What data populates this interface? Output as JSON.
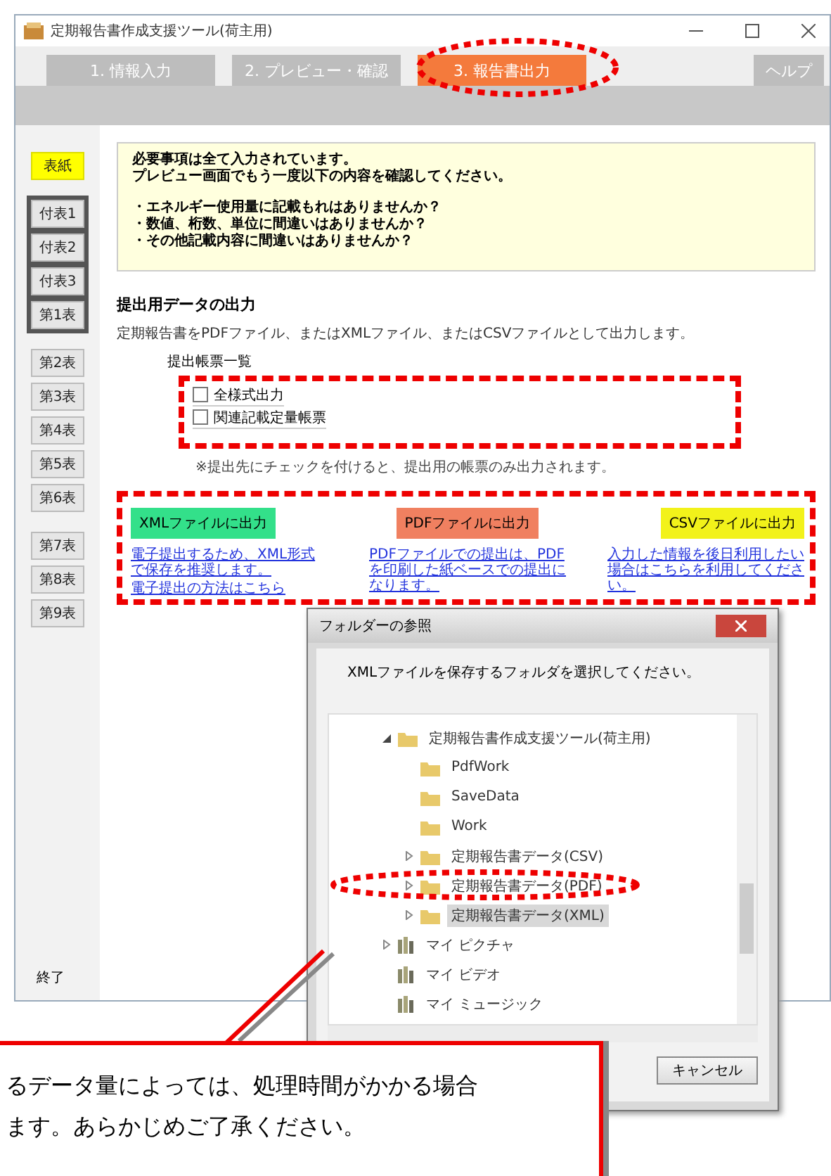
{
  "window": {
    "title": "定期報告書作成支援ツール(荷主用)"
  },
  "tabs": [
    {
      "label": "1. 情報入力",
      "selected": false
    },
    {
      "label": "2. プレビュー・確認",
      "selected": false
    },
    {
      "label": "3. 報告書出力",
      "selected": true
    }
  ],
  "help_button": "ヘルプ",
  "sidebar": {
    "groups": [
      {
        "boxed": false,
        "items": [
          {
            "label": "表紙",
            "selected": true
          }
        ]
      },
      {
        "boxed": true,
        "items": [
          {
            "label": "付表1",
            "selected": false
          },
          {
            "label": "付表2",
            "selected": false
          },
          {
            "label": "付表3",
            "selected": false
          },
          {
            "label": "第1表",
            "selected": false
          }
        ]
      },
      {
        "boxed": false,
        "items": [
          {
            "label": "第2表",
            "selected": false
          },
          {
            "label": "第3表",
            "selected": false
          },
          {
            "label": "第4表",
            "selected": false
          },
          {
            "label": "第5表",
            "selected": false
          },
          {
            "label": "第6表",
            "selected": false
          }
        ]
      },
      {
        "boxed": false,
        "items": [
          {
            "label": "第7表",
            "selected": false
          },
          {
            "label": "第8表",
            "selected": false
          },
          {
            "label": "第9表",
            "selected": false
          }
        ]
      }
    ],
    "exit_button": "終了"
  },
  "message": {
    "paragraphs": [
      [
        "必要事項は全て入力されています。",
        "プレビュー画面でもう一度以下の内容を確認してください。"
      ],
      [
        "・エネルギー使用量に記載もれはありませんか？",
        "・数値、桁数、単位に間違いはありませんか？",
        "・その他記載内容に間違いはありませんか？"
      ]
    ]
  },
  "output": {
    "title": "提出用データの出力",
    "description": "定期報告書をPDFファイル、またはXMLファイル、またはCSVファイルとして出力します。",
    "list_label": "提出帳票一覧",
    "options": [
      {
        "label": "全様式出力",
        "checked": false
      },
      {
        "label": "関連記載定量帳票",
        "checked": false
      }
    ],
    "note": "※提出先にチェックを付けると、提出用の帳票のみ出力されます。",
    "buttons": [
      {
        "label": "XMLファイルに出力",
        "color": "#33e08a",
        "links": [
          "電子提出するため、XML形式で保存を推奨します。",
          "電子提出の方法はこちら"
        ]
      },
      {
        "label": "PDFファイルに出力",
        "color": "#f08060",
        "links": [
          "PDFファイルでの提出は、PDFを印刷した紙ベースでの提出になります。"
        ]
      },
      {
        "label": "CSVファイルに出力",
        "color": "#f2f21a",
        "links": [
          "入力した情報を後日利用したい場合はこちらを利用してください。"
        ]
      }
    ]
  },
  "dialog": {
    "title": "フォルダーの参照",
    "instruction": "XMLファイルを保存するフォルダを選択してください。",
    "tree": [
      {
        "label": "定期報告書作成支援ツール(荷主用)",
        "kind": "folder",
        "expanded": true,
        "selected": false,
        "children": [
          {
            "label": "PdfWork",
            "kind": "folder",
            "selected": false
          },
          {
            "label": "SaveData",
            "kind": "folder",
            "selected": false
          },
          {
            "label": "Work",
            "kind": "folder",
            "selected": false
          },
          {
            "label": "定期報告書データ(CSV)",
            "kind": "folder",
            "expanded": false,
            "selected": false
          },
          {
            "label": "定期報告書データ(PDF)",
            "kind": "folder",
            "expanded": false,
            "selected": false
          },
          {
            "label": "定期報告書データ(XML)",
            "kind": "folder",
            "expanded": false,
            "selected": true
          }
        ]
      },
      {
        "label": "マイ ピクチャ",
        "kind": "library",
        "expanded": false,
        "selected": false
      },
      {
        "label": "マイ ビデオ",
        "kind": "library",
        "selected": false
      },
      {
        "label": "マイ ミュージック",
        "kind": "library",
        "selected": false
      }
    ],
    "cancel_button": "キャンセル"
  },
  "callout": {
    "lines": [
      "るデータ量によっては、処理時間がかかる場合",
      "ます。あらかじめご了承ください。"
    ]
  }
}
